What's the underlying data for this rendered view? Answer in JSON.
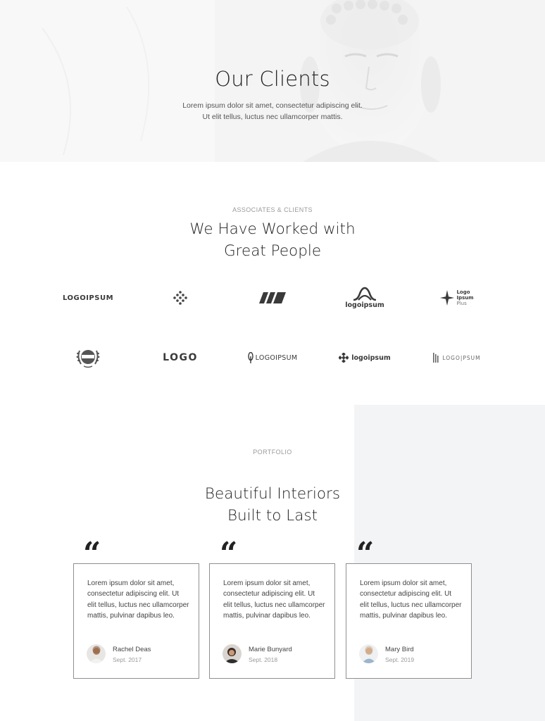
{
  "hero": {
    "title": "Our Clients",
    "subtitle_line1": "Lorem ipsum dolor sit amet, consectetur adipiscing elit.",
    "subtitle_line2": "Ut elit tellus, luctus nec ullamcorper mattis."
  },
  "clients": {
    "eyebrow": "ASSOCIATES & CLIENTS",
    "title_line1": "We Have Worked with",
    "title_line2": "Great People",
    "logos_row1": {
      "logo1": "LOGOIPSUM",
      "logo4": "logoipsum",
      "logo5_line1": "Logo",
      "logo5_line2": "Ipsum",
      "logo5_line3": "Plus"
    },
    "logos_row2": {
      "logo2": "LOGO",
      "logo3": "LOGOIPSUM",
      "logo4": "logoipsum",
      "logo5": "LOGO|PSUM"
    }
  },
  "portfolio": {
    "eyebrow": "PORTFOLIO",
    "title_line1": "Beautiful Interiors",
    "title_line2": "Built to Last",
    "quote_glyph": "“",
    "testimonials": [
      {
        "text": "Lorem ipsum dolor sit amet, consectetur adipiscing elit. Ut elit tellus, luctus nec ullamcorper mattis, pulvinar dapibus leo.",
        "name": "Rachel Deas",
        "date": "Sept. 2017"
      },
      {
        "text": "Lorem ipsum dolor sit amet, consectetur adipiscing elit. Ut elit tellus, luctus nec ullamcorper mattis, pulvinar dapibus leo.",
        "name": "Marie Bunyard",
        "date": "Sept. 2018"
      },
      {
        "text": "Lorem ipsum dolor sit amet, consectetur adipiscing elit. Ut elit tellus, luctus nec ullamcorper mattis, pulvinar dapibus leo.",
        "name": "Mary Bird",
        "date": "Sept. 2019"
      }
    ]
  },
  "colors": {
    "text_dark": "#222222",
    "text_body": "#444444",
    "text_muted": "#9a9a9a",
    "panel_grey": "#f3f4f6",
    "card_border": "#8f8f8f"
  }
}
